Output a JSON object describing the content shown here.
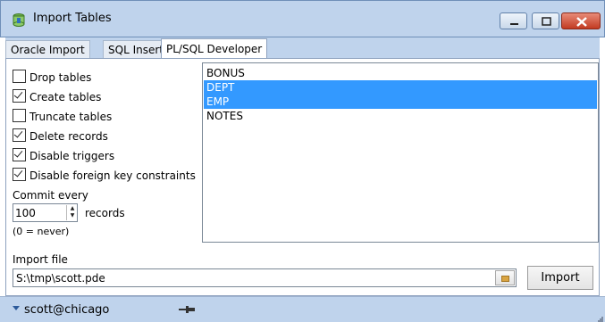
{
  "window": {
    "title": "Import Tables",
    "icons": [
      "app-icon",
      "minimize-icon",
      "maximize-icon",
      "close-icon"
    ],
    "accent": "#bfd3ec",
    "close_color": "#c23b22"
  },
  "tabs": [
    {
      "label": "Oracle Import",
      "selected": false
    },
    {
      "label": "SQL Inserts",
      "selected": false
    },
    {
      "label": "PL/SQL Developer",
      "selected": true
    }
  ],
  "options": [
    {
      "label": "Drop tables",
      "checked": false
    },
    {
      "label": "Create tables",
      "checked": true
    },
    {
      "label": "Truncate tables",
      "checked": false
    },
    {
      "label": "Delete records",
      "checked": true
    },
    {
      "label": "Disable triggers",
      "checked": true
    },
    {
      "label": "Disable foreign key constraints",
      "checked": true
    }
  ],
  "commit": {
    "label": "Commit every",
    "value": "100",
    "unit": "records",
    "note": "(0 = never)"
  },
  "tables": [
    {
      "name": "BONUS",
      "selected": false
    },
    {
      "name": "DEPT",
      "selected": true
    },
    {
      "name": "EMP",
      "selected": true
    },
    {
      "name": "NOTES",
      "selected": false
    }
  ],
  "selection_color": "#3399ff",
  "import_file": {
    "label": "Import file",
    "value": "S:\\tmp\\scott.pde",
    "browse_icon": "folder-icon"
  },
  "import_button": "Import",
  "status": {
    "connection": "scott@chicago",
    "icons": [
      "dropdown-arrow-icon",
      "pin-icon",
      "resize-grip-icon"
    ]
  }
}
